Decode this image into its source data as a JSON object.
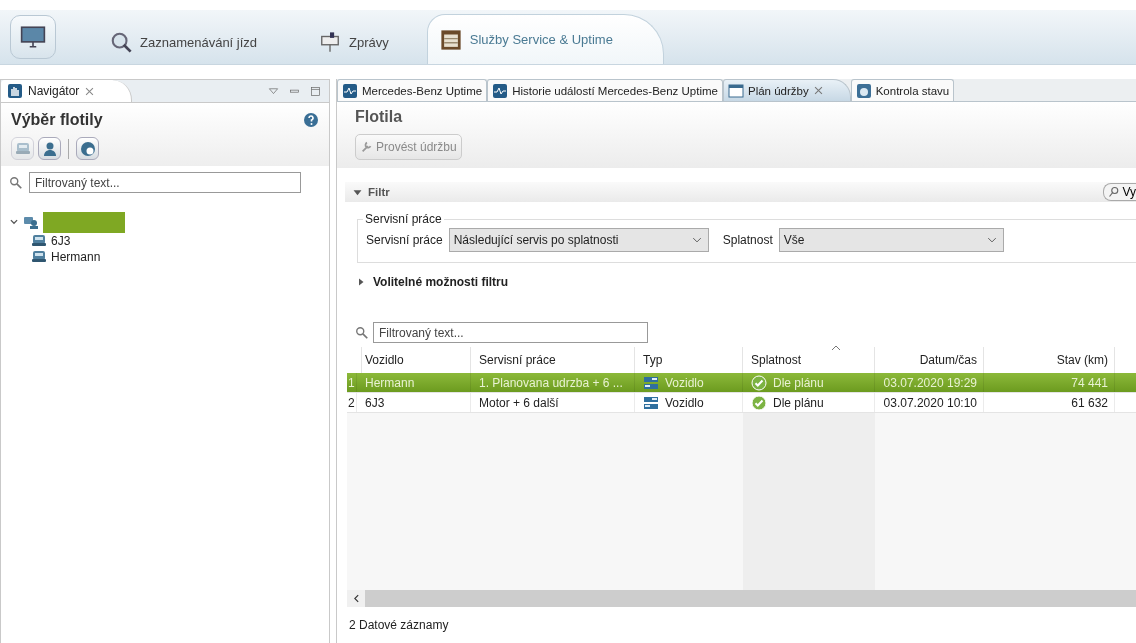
{
  "top_tabs": [
    {
      "label": "Zaznamenávání jízd",
      "selected": false,
      "kind": "search"
    },
    {
      "label": "Zprávy",
      "selected": false,
      "kind": "mail"
    },
    {
      "label": "Služby Service & Uptime",
      "selected": true,
      "kind": "service"
    }
  ],
  "navigator": {
    "tab": "Navigátor",
    "title": "Výběr flotily",
    "toolbar": [
      {
        "kind": "vehicle",
        "disabled": true
      },
      {
        "kind": "driver",
        "disabled": false
      },
      {
        "kind": "group",
        "disabled": false
      }
    ],
    "filter": {
      "placeholder": "Filtrovaný text..."
    },
    "tree": [
      {
        "redacted": true,
        "expanded": true,
        "children": [
          {
            "label": "6J3"
          },
          {
            "label": "Hermann"
          }
        ]
      }
    ]
  },
  "editor_tabs": [
    {
      "label": "Mercedes-Benz Uptime",
      "selected": false,
      "closable": false
    },
    {
      "label": "Historie událostí Mercedes-Benz Uptime",
      "selected": false,
      "closable": false
    },
    {
      "label": "Plán údržby",
      "selected": true,
      "closable": true
    },
    {
      "label": "Kontrola stavu",
      "selected": false,
      "closable": false
    }
  ],
  "content": {
    "title": "Flotila",
    "action": {
      "label": "Provést údržbu",
      "disabled": true
    },
    "filter": {
      "title": "Filtr",
      "expanded": true,
      "search_button": "Vy",
      "legend": "Servisní práce",
      "fields": [
        {
          "label": "Servisní práce",
          "value": "Následující servis po splatnosti"
        },
        {
          "label": "Splatnost",
          "value": "Vše"
        }
      ],
      "optional": {
        "label": "Volitelné možnosti filtru",
        "expanded": false
      }
    },
    "table_filter": {
      "placeholder": "Filtrovaný text..."
    },
    "columns": [
      {
        "label": "Vozidlo",
        "kind": "text",
        "sorted": false
      },
      {
        "label": "Servisní práce",
        "kind": "text",
        "sorted": false
      },
      {
        "label": "Typ",
        "kind": "type",
        "sorted": false
      },
      {
        "label": "Splatnost",
        "kind": "status",
        "sorted": true
      },
      {
        "label": "Datum/čas",
        "kind": "date",
        "sorted": false
      },
      {
        "label": "Stav (km)",
        "kind": "number",
        "sorted": false
      }
    ],
    "rows": [
      {
        "number": "1",
        "selected": true,
        "cells": [
          "Hermann",
          "1. Planovana udrzba + 6 ...",
          "Vozidlo",
          "Dle plánu",
          "03.07.2020 19:29",
          "74 441"
        ]
      },
      {
        "number": "2",
        "selected": false,
        "cells": [
          "6J3",
          "Motor + 6 další",
          "Vozidlo",
          "Dle plánu",
          "03.07.2020 10:10",
          "61 632"
        ]
      }
    ],
    "footer": "2 Datové záznamy"
  }
}
